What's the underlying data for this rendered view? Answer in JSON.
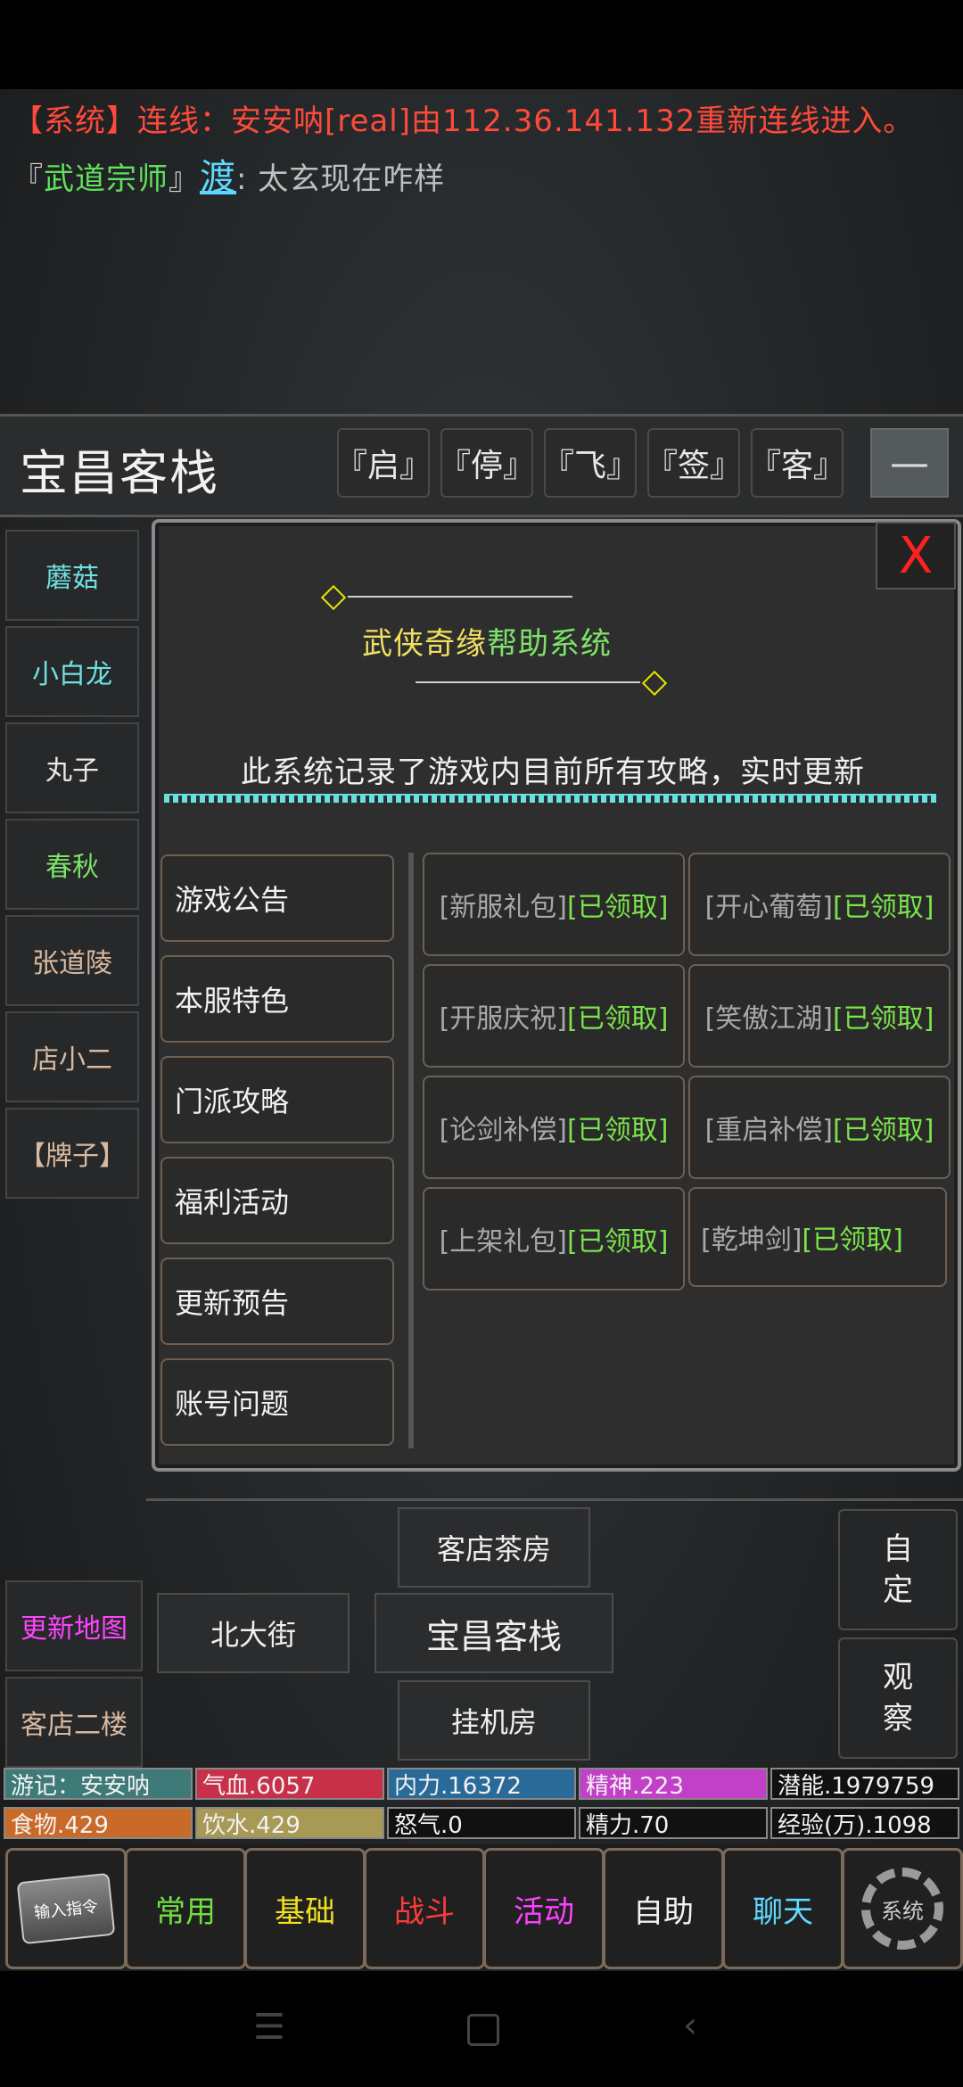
{
  "chat": {
    "line1": "【系统】连线：安安呐[real]由112.36.141.132重新连线进入。",
    "line2_open": "『",
    "line2_title": "武道宗师",
    "line2_close": "』",
    "line2_name": "渡",
    "line2_text": ": 太玄现在咋样"
  },
  "header": {
    "room": "宝昌客栈",
    "buttons": [
      "『启』",
      "『停』",
      "『飞』",
      "『签』",
      "『客』"
    ],
    "minimize": "—"
  },
  "npcs": [
    {
      "label": "蘑菇",
      "color": "#6fe0e0"
    },
    {
      "label": "小白龙",
      "color": "#6fe0e0"
    },
    {
      "label": "丸子",
      "color": "#e8e8e8"
    },
    {
      "label": "春秋",
      "color": "#7de36a"
    },
    {
      "label": "张道陵",
      "color": "#d8b9a0"
    },
    {
      "label": "店小二",
      "color": "#d8b9a0"
    },
    {
      "label": "【牌子】",
      "color": "#d8b9a0"
    }
  ],
  "dialog": {
    "close": "X",
    "title_a": "武侠奇缘",
    "title_b": "帮助系统",
    "desc": "此系统记录了游戏内目前所有攻略，实时更新",
    "menu": [
      "游戏公告",
      "本服特色",
      "门派攻略",
      "福利活动",
      "更新预告",
      "账号问题"
    ],
    "gifts": [
      {
        "name": "[新服礼包]",
        "status": "[已领取]"
      },
      {
        "name": "[开心葡萄]",
        "status": "[已领取]"
      },
      {
        "name": "[开服庆祝]",
        "status": "[已领取]"
      },
      {
        "name": "[笑傲江湖]",
        "status": "[已领取]"
      },
      {
        "name": "[论剑补偿]",
        "status": "[已领取]"
      },
      {
        "name": "[重启补偿]",
        "status": "[已领取]"
      },
      {
        "name": "[上架礼包]",
        "status": "[已领取]"
      },
      {
        "name": "[乾坤剑]",
        "status": "[已领取]"
      }
    ]
  },
  "map": {
    "north": "客店茶房",
    "west": "北大街",
    "center": "宝昌客栈",
    "south": "挂机房",
    "update_map": "更新地图",
    "upstairs": "客店二楼",
    "custom": "自\n定",
    "observe": "观\n察"
  },
  "stats": [
    {
      "label": "游记：安安呐",
      "bg": "#3d7a78"
    },
    {
      "label": "气血.6057",
      "bg": "#c8304a"
    },
    {
      "label": "内力.16372",
      "bg": "#2a6a98"
    },
    {
      "label": "精神.223",
      "bg": "#c23fc8"
    },
    {
      "label": "潜能.1979759",
      "bg": "#111111"
    },
    {
      "label": "食物.429",
      "bg": "#c96a28"
    },
    {
      "label": "饮水.429",
      "bg": "#a89a55"
    },
    {
      "label": "怒气.0",
      "bg": "#111111"
    },
    {
      "label": "精力.70",
      "bg": "#111111"
    },
    {
      "label": "经验(万).1098",
      "bg": "#111111"
    }
  ],
  "nav": {
    "input": "输入指令",
    "items": [
      {
        "label": "常用",
        "color": "#6fe040"
      },
      {
        "label": "基础",
        "color": "#f0e020"
      },
      {
        "label": "战斗",
        "color": "#ff3a3a"
      },
      {
        "label": "活动",
        "color": "#ff40ff"
      },
      {
        "label": "自助",
        "color": "#f2f2f2"
      },
      {
        "label": "聊天",
        "color": "#60d8ff"
      }
    ],
    "system": "系统"
  }
}
